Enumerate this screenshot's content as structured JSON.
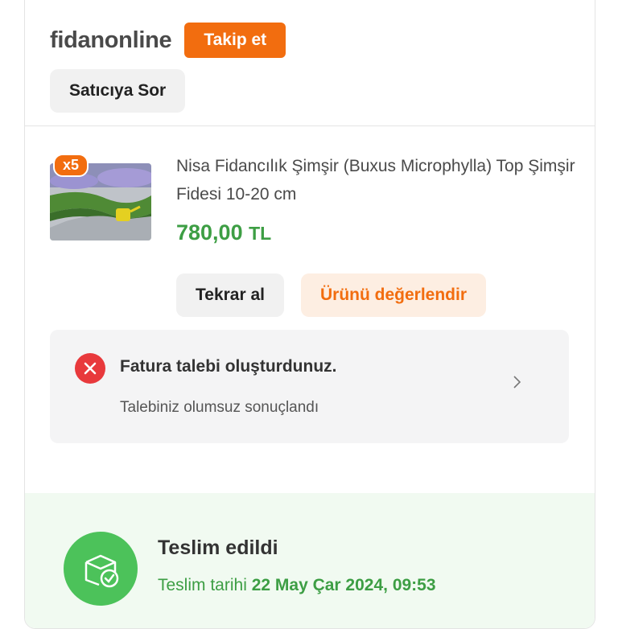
{
  "seller": {
    "name": "fidanonline",
    "follow_label": "Takip et",
    "ask_label": "Satıcıya Sor"
  },
  "product": {
    "quantity_badge": "x5",
    "title": "Nisa Fidancılık Şimşir (Buxus Microphylla) Top Şimşir Fidesi 10-20 cm",
    "price_value": "780,00",
    "price_currency": "TL",
    "rebuy_label": "Tekrar al",
    "rate_label": "Ürünü değerlendir"
  },
  "invoice": {
    "title": "Fatura talebi oluşturdunuz.",
    "subtitle": "Talebiniz olumsuz sonuçlandı",
    "status_icon": "error-x-icon"
  },
  "delivery": {
    "status": "Teslim edildi",
    "date_label": "Teslim tarihi",
    "date_value": "22 May Çar 2024, 09:53",
    "icon": "package-check-icon"
  },
  "colors": {
    "accent_orange": "#f26d0f",
    "success_green": "#3d9e44",
    "error_red": "#e8393c"
  }
}
